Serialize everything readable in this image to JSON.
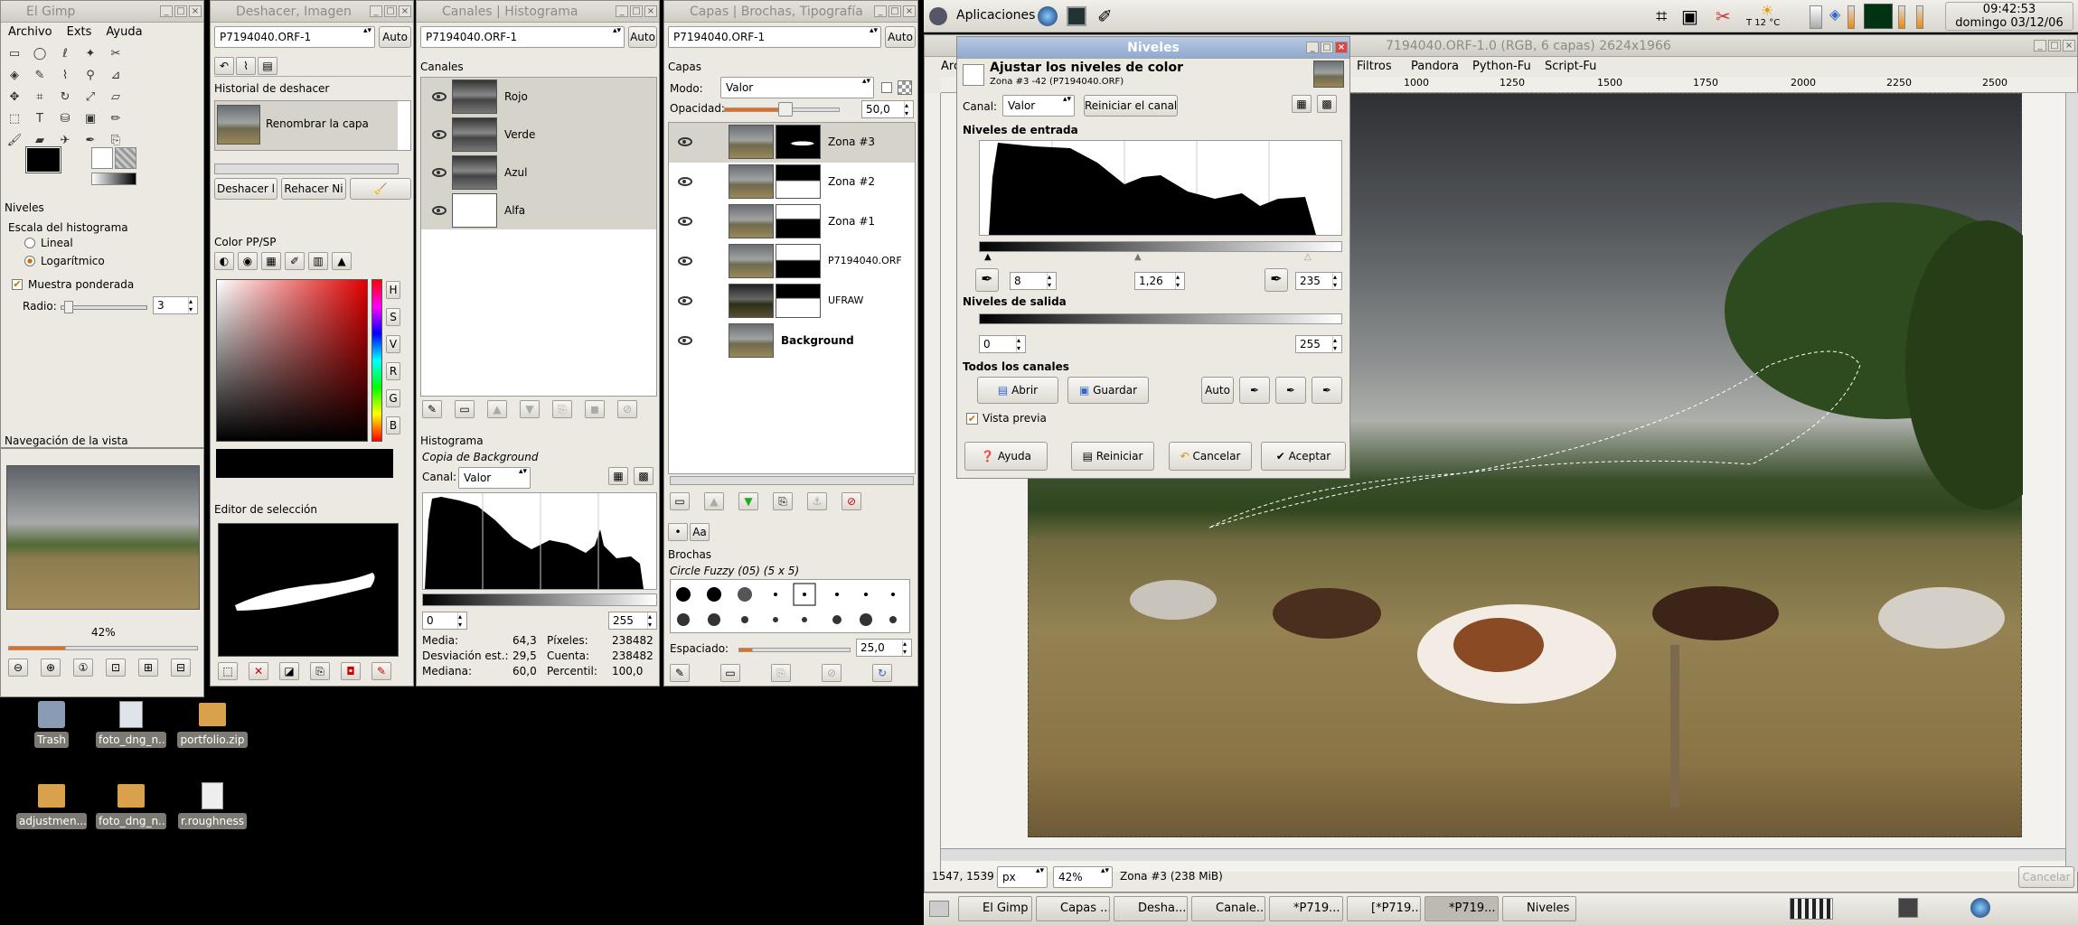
{
  "toolbox": {
    "title": "El Gimp",
    "menu": [
      "Archivo",
      "Exts",
      "Ayuda"
    ]
  },
  "undo": {
    "title": "Deshacer, Imagen",
    "image_combo": "P7194040.ORF-1",
    "auto": "Auto",
    "header": "Historial de deshacer",
    "item": "Renombrar la capa",
    "undo_btn": "Deshacer l",
    "redo_btn": "Rehacer Ni"
  },
  "channels": {
    "title": "Canales | Histograma",
    "image_combo": "P7194040.ORF-1",
    "auto": "Auto",
    "header": "Canales",
    "items": [
      "Rojo",
      "Verde",
      "Azul",
      "Alfa"
    ]
  },
  "layers": {
    "title": "Capas | Brochas, Tipografía",
    "image_combo": "P7194040.ORF-1",
    "auto": "Auto",
    "header": "Capas",
    "mode_label": "Modo:",
    "mode": "Valor",
    "opacity_label": "Opacidad:",
    "opacity": "50,0",
    "items": [
      "Zona #3",
      "Zona #2",
      "Zona #1",
      "P7194040.ORF",
      "UFRAW",
      "Background"
    ]
  },
  "levels_dock": {
    "header": "Niveles",
    "scale_label": "Escala del histograma",
    "linear": "Lineal",
    "log": "Logarítmico",
    "weighted": "Muestra ponderada",
    "radius_label": "Radio:",
    "radius": "3"
  },
  "navigation": {
    "header": "Navegación de la vista",
    "zoom": "42%"
  },
  "color": {
    "header": "Color PP/SP",
    "side": [
      "H",
      "S",
      "V",
      "R",
      "G",
      "B"
    ]
  },
  "selection": {
    "header": "Editor de selección"
  },
  "histogram": {
    "header": "Histograma",
    "subtitle": "Copia de Background",
    "channel_label": "Canal:",
    "channel": "Valor",
    "low": "0",
    "high": "255",
    "stats": [
      [
        "Media:",
        "64,3",
        "Píxeles:",
        "238482"
      ],
      [
        "Desviación est.:",
        "29,5",
        "Cuenta:",
        "238482"
      ],
      [
        "Mediana:",
        "60,0",
        "Percentil:",
        "100,0"
      ]
    ]
  },
  "brushes": {
    "header": "Brochas",
    "name": "Circle Fuzzy (05) (5 x 5)",
    "spacing_label": "Espaciado:",
    "spacing": "25,0"
  },
  "levels_dialog": {
    "title": "Niveles",
    "heading": "Ajustar los niveles de color",
    "sub": "Zona #3 -42 (P7194040.ORF)",
    "channel_label": "Canal:",
    "channel": "Valor",
    "reset_channel": "Reiniciar el canal",
    "input_label": "Niveles de entrada",
    "in_low": "8",
    "in_gamma": "1,26",
    "in_high": "235",
    "output_label": "Niveles de salida",
    "out_low": "0",
    "out_high": "255",
    "all_channels": "Todos los canales",
    "open": "Abrir",
    "save": "Guardar",
    "auto": "Auto",
    "preview": "Vista previa",
    "help": "Ayuda",
    "reset": "Reiniciar",
    "cancel": "Cancelar",
    "ok": "Aceptar"
  },
  "image_window": {
    "title": "7194040.ORF-1.0 (RGB, 6 capas) 2624x1966",
    "menu": [
      "Arch",
      "Filtros",
      "Pandora",
      "Python-Fu",
      "Script-Fu"
    ],
    "ruler": [
      "1000",
      "1250",
      "1500",
      "1750",
      "2000",
      "2250",
      "2500"
    ],
    "coords": "1547, 1539",
    "unit": "px",
    "zoom": "42%",
    "status": "Zona #3 (238 MiB)",
    "cancel": "Cancelar"
  },
  "panel": {
    "apps": "Aplicaciones",
    "temp": "T 12 °C",
    "time": "09:42:53",
    "date": "domingo 03/12/06"
  },
  "desktop": [
    {
      "label": "Trash"
    },
    {
      "label": "foto_dng_n..."
    },
    {
      "label": "portfolio.zip"
    },
    {
      "label": "adjustmen..."
    },
    {
      "label": "foto_dng_n..."
    },
    {
      "label": "r.roughness"
    }
  ],
  "taskbar": [
    "El Gimp",
    "Capas ...",
    "Desha...",
    "Canale...",
    "*P719...",
    "[*P719...",
    "*P719...",
    "Niveles"
  ]
}
